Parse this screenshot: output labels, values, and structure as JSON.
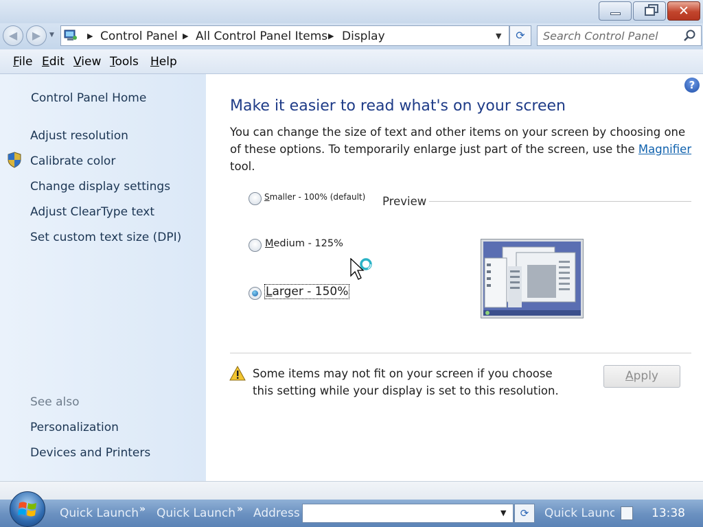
{
  "window": {
    "minimize_icon": "minimize-icon",
    "maximize_icon": "restore-icon",
    "close_icon": "close-icon",
    "close_glyph": "✕"
  },
  "nav": {
    "back_glyph": "◀",
    "forward_glyph": "▶",
    "breadcrumbs": [
      "Control Panel",
      "All Control Panel Items",
      "Display"
    ],
    "crumb_arrow": "▶",
    "dropdown_glyph": "▼",
    "refresh_glyph": "⟳",
    "search_placeholder": "Search Control Panel"
  },
  "menu": {
    "items": [
      {
        "key": "F",
        "rest": "ile"
      },
      {
        "key": "E",
        "rest": "dit"
      },
      {
        "key": "V",
        "rest": "iew"
      },
      {
        "key": "T",
        "rest": "ools"
      },
      {
        "key": "H",
        "rest": "elp"
      }
    ]
  },
  "sidebar": {
    "home": "Control Panel Home",
    "links": [
      "Adjust resolution",
      "Calibrate color",
      "Change display settings",
      "Adjust ClearType text",
      "Set custom text size (DPI)"
    ],
    "see_also_label": "See also",
    "see_also_links": [
      "Personalization",
      "Devices and Printers"
    ]
  },
  "main": {
    "help_glyph": "?",
    "heading": "Make it easier to read what's on your screen",
    "desc_before": "You can change the size of text and other items on your screen by choosing one of these options. To temporarily enlarge just part of the screen, use the ",
    "desc_link": "Magnifier",
    "desc_after": " tool.",
    "options": [
      {
        "key": "S",
        "rest": "maller - 100% (default)",
        "checked": false
      },
      {
        "key": "M",
        "rest": "edium - 125%",
        "checked": false
      },
      {
        "key": "L",
        "rest": "arger - 150%",
        "checked": true
      }
    ],
    "preview_label": "Preview",
    "warning": "Some items may not fit on your screen if you choose this setting while your display is set to this resolution.",
    "apply_key": "A",
    "apply_rest": "pply"
  },
  "taskbar": {
    "quick_launch_1": "Quick Launch",
    "quick_launch_2": "Quick Launch",
    "address_label": "Address",
    "quick_launch_3": "Quick Launch",
    "chevron": "»",
    "clock": "13:38"
  },
  "colors": {
    "heading": "#1e3b87",
    "link": "#0f61ad",
    "sidebar_link": "#1b3553"
  }
}
